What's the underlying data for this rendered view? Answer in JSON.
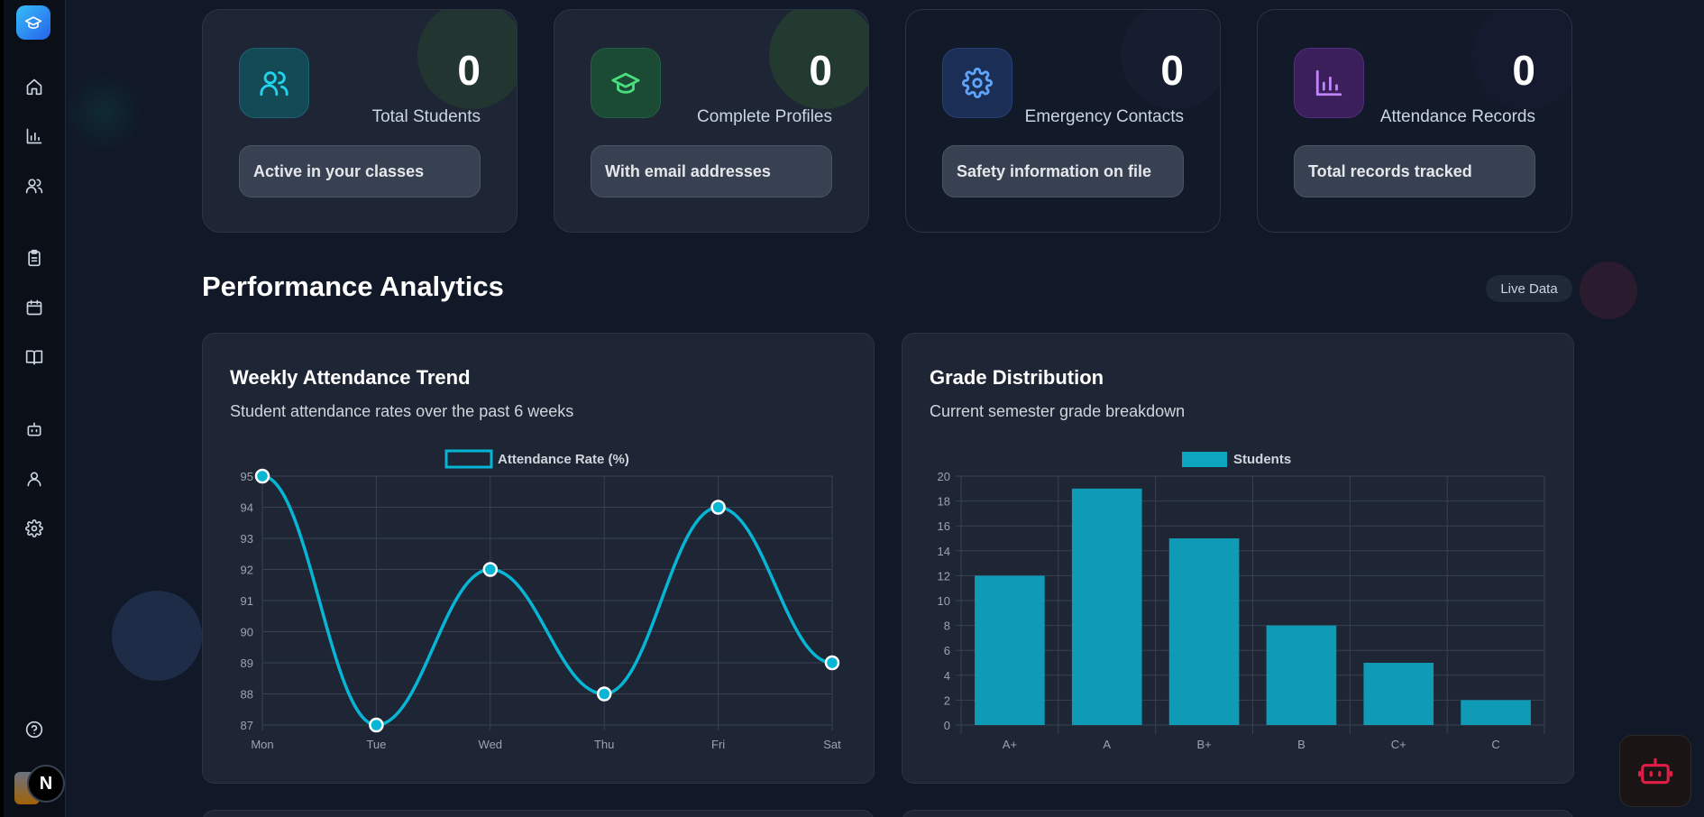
{
  "sidebar": {
    "icons": [
      "graduation-cap-icon",
      "home-icon",
      "bar-chart-icon",
      "users-icon",
      "clipboard-icon",
      "calendar-icon",
      "book-open-icon",
      "bot-icon",
      "user-icon",
      "settings-icon",
      "help-icon"
    ],
    "badge": "N"
  },
  "stats": [
    {
      "value": "0",
      "label": "Total Students",
      "note": "Active in your classes",
      "icon": "users-icon",
      "color": "#22d3ee"
    },
    {
      "value": "0",
      "label": "Complete Profiles",
      "note": "With email addresses",
      "icon": "graduation-cap-icon",
      "color": "#4ade80"
    },
    {
      "value": "0",
      "label": "Emergency Contacts",
      "note": "Safety information on file",
      "icon": "gear-icon",
      "color": "#60a5fa"
    },
    {
      "value": "0",
      "label": "Attendance Records",
      "note": "Total records tracked",
      "icon": "bar-chart-icon",
      "color": "#c084fc"
    }
  ],
  "analytics": {
    "title": "Performance Analytics",
    "badge": "Live Data"
  },
  "charts": {
    "attendance": {
      "title": "Weekly Attendance Trend",
      "subtitle": "Student attendance rates over the past 6 weeks"
    },
    "grades": {
      "title": "Grade Distribution",
      "subtitle": "Current semester grade breakdown"
    }
  },
  "chart_data": [
    {
      "type": "line",
      "legend": "Attendance Rate (%)",
      "categories": [
        "Mon",
        "Tue",
        "Wed",
        "Thu",
        "Fri",
        "Sat"
      ],
      "values": [
        95,
        87,
        92,
        88,
        94,
        89
      ],
      "ylim": [
        87,
        95
      ],
      "yticks": [
        95,
        94,
        93,
        92,
        91,
        90,
        89,
        88,
        87
      ],
      "color": "#06b6d4",
      "grid": true,
      "legend_position": "top"
    },
    {
      "type": "bar",
      "legend": "Students",
      "categories": [
        "A+",
        "A",
        "B+",
        "B",
        "C+",
        "C"
      ],
      "values": [
        12,
        19,
        15,
        8,
        5,
        2
      ],
      "ylim": [
        0,
        20
      ],
      "yticks": [
        20,
        18,
        16,
        14,
        12,
        10,
        8,
        6,
        4,
        2,
        0
      ],
      "color": "#0ea5c0",
      "grid": true,
      "legend_position": "top"
    }
  ]
}
